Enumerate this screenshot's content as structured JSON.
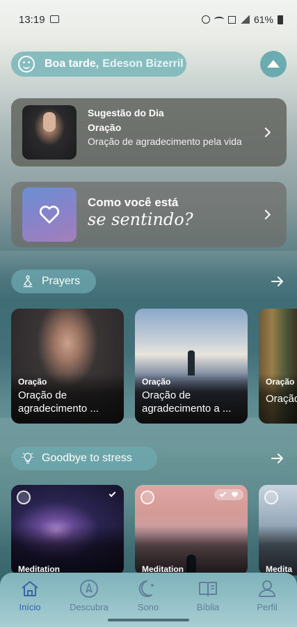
{
  "status_bar": {
    "time": "13:19",
    "battery": "61%"
  },
  "greeting": {
    "prefix": "Boa tarde,",
    "name": "Edeson Bizerril"
  },
  "suggestion": {
    "title": "Sugestão do Dia",
    "category": "Oração",
    "description": "Oração de agradecimento pela vida"
  },
  "mood": {
    "line1": "Como você está",
    "line2": "se sentindo?"
  },
  "sections": {
    "prayers": {
      "label": "Prayers",
      "cards": [
        {
          "category": "Oração",
          "title": "Oração de agradecimento ..."
        },
        {
          "category": "Oração",
          "title": "Oração de agradecimento a ..."
        },
        {
          "category": "Oração",
          "title": "Oração afasta"
        }
      ]
    },
    "stress": {
      "label": "Goodbye to stress",
      "cards": [
        {
          "category": "Meditation"
        },
        {
          "category": "Meditation"
        },
        {
          "category": "Medita"
        }
      ]
    }
  },
  "nav": {
    "items": [
      {
        "label": "Início",
        "icon": "home-icon",
        "active": true
      },
      {
        "label": "Descubra",
        "icon": "compass-icon",
        "active": false
      },
      {
        "label": "Sono",
        "icon": "moon-icon",
        "active": false
      },
      {
        "label": "Bíblia",
        "icon": "book-icon",
        "active": false
      },
      {
        "label": "Perfil",
        "icon": "profile-icon",
        "active": false
      }
    ]
  },
  "colors": {
    "accent": "#3a62a8",
    "pill": "#6eaab2",
    "card_dark": "#5f625c"
  }
}
